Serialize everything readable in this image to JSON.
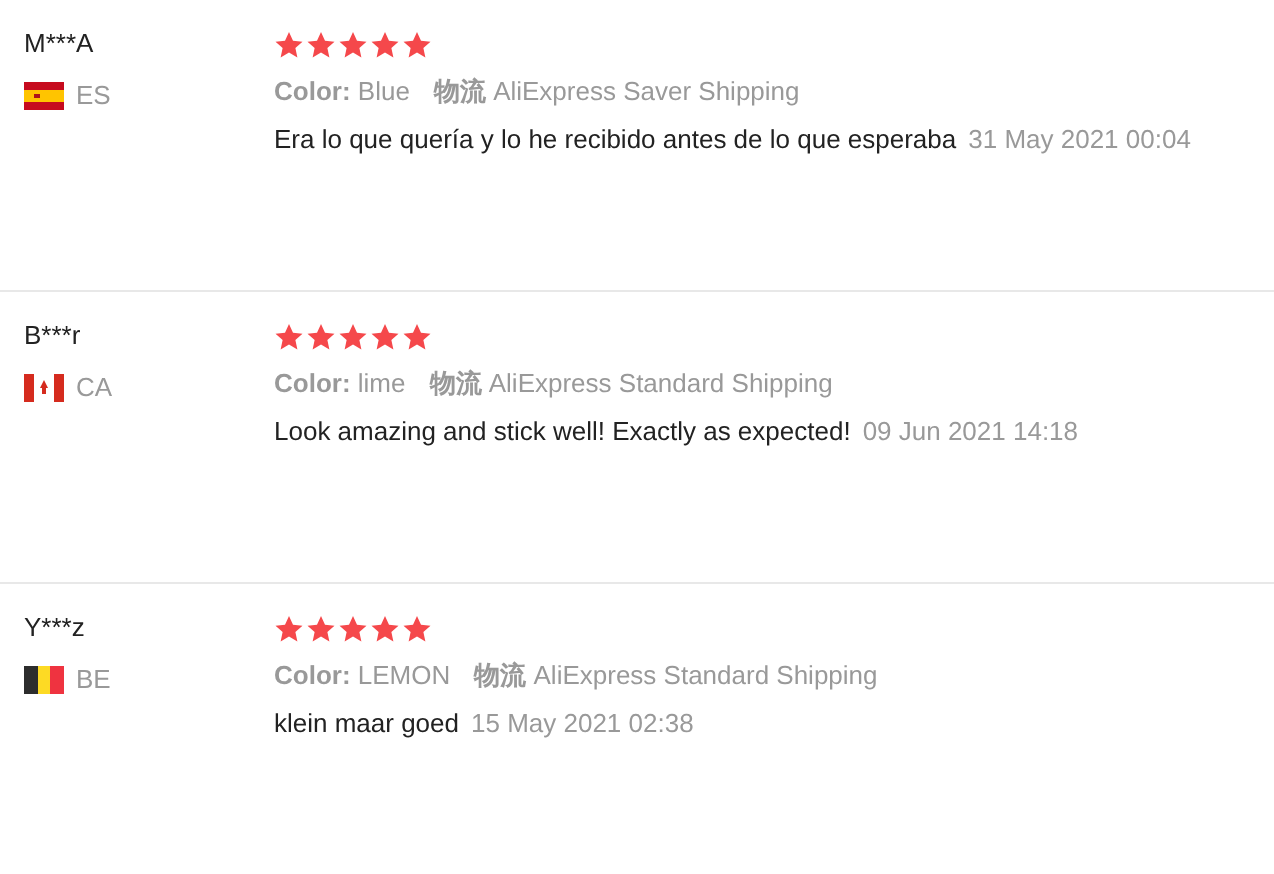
{
  "reviews": [
    {
      "user": "M***A",
      "flag": {
        "kind": "spain"
      },
      "country": "ES",
      "stars": 5,
      "color_label": "Color:",
      "color_value": "Blue",
      "logistics_label": "物流",
      "shipping": "AliExpress Saver Shipping",
      "text": "Era lo que quería y lo he recibido antes de lo que esperaba",
      "date": "31 May 2021 00:04"
    },
    {
      "user": "B***r",
      "flag": {
        "kind": "canada"
      },
      "country": "CA",
      "stars": 5,
      "color_label": "Color:",
      "color_value": "lime",
      "logistics_label": "物流",
      "shipping": "AliExpress Standard Shipping",
      "text": "Look amazing and stick well! Exactly as expected!",
      "date": "09 Jun 2021 14:18"
    },
    {
      "user": "Y***z",
      "flag": {
        "kind": "belgium"
      },
      "country": "BE",
      "stars": 5,
      "color_label": "Color:",
      "color_value": "LEMON",
      "logistics_label": "物流",
      "shipping": "AliExpress Standard Shipping",
      "text": "klein maar goed",
      "date": "15 May 2021 02:38"
    }
  ]
}
